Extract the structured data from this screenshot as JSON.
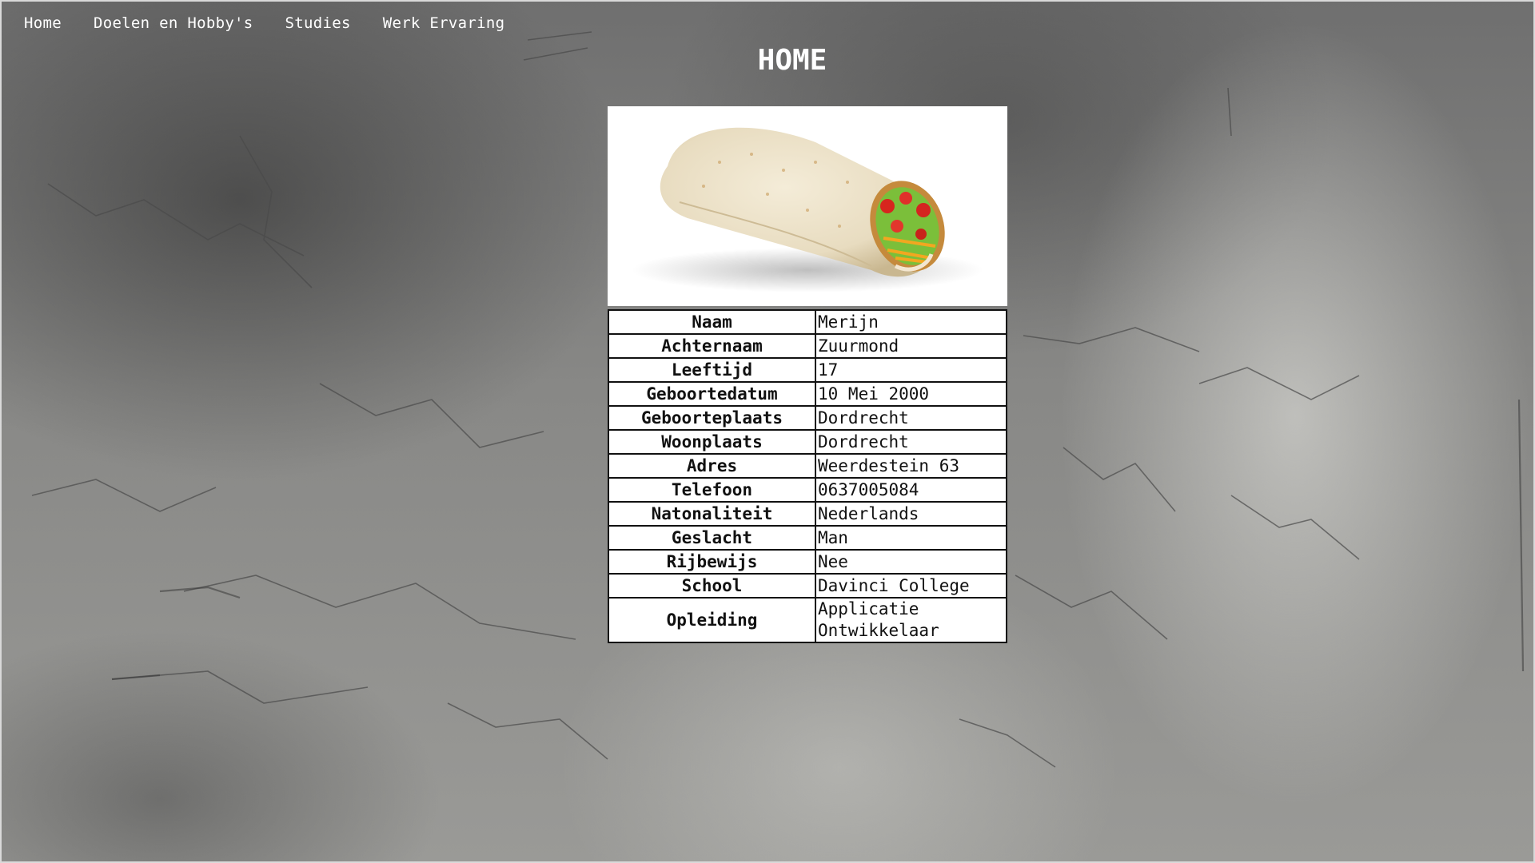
{
  "nav": {
    "items": [
      {
        "label": "Home"
      },
      {
        "label": "Doelen en Hobby's"
      },
      {
        "label": "Studies"
      },
      {
        "label": "Werk Ervaring"
      }
    ]
  },
  "page": {
    "title": "HOME"
  },
  "image": {
    "subject": "burrito wrap photo"
  },
  "info_table": {
    "rows": [
      {
        "label": "Naam",
        "value": "Merijn"
      },
      {
        "label": "Achternaam",
        "value": "Zuurmond"
      },
      {
        "label": "Leeftijd",
        "value": "17"
      },
      {
        "label": "Geboortedatum",
        "value": "10 Mei 2000"
      },
      {
        "label": "Geboorteplaats",
        "value": "Dordrecht"
      },
      {
        "label": "Woonplaats",
        "value": "Dordrecht"
      },
      {
        "label": "Adres",
        "value": "Weerdestein 63"
      },
      {
        "label": "Telefoon",
        "value": "0637005084"
      },
      {
        "label": "Natonaliteit",
        "value": "Nederlands"
      },
      {
        "label": "Geslacht",
        "value": "Man"
      },
      {
        "label": "Rijbewijs",
        "value": "Nee"
      },
      {
        "label": "School",
        "value": "Davinci College"
      },
      {
        "label": "Opleiding",
        "value_line1": "Applicatie",
        "value_line2": "Ontwikkelaar"
      }
    ]
  },
  "colors": {
    "text_light": "#ffffff",
    "table_bg": "#ffffff",
    "table_border": "#111111"
  }
}
